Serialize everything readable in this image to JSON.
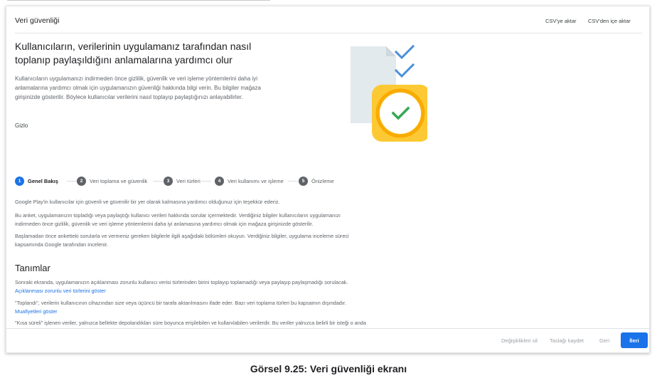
{
  "header": {
    "title": "Veri güvenliği",
    "export_label": "CSV'ye aktar",
    "import_label": "CSV'den içe aktar"
  },
  "hero": {
    "title": "Kullanıcıların, verilerinin uygulamanız tarafından nasıl toplanıp paylaşıldığını anlamalarına yardımcı olur",
    "description": "Kullanıcıların uygulamanızı indirmeden önce gizlilik, güvenlik ve veri işleme yöntemlerini daha iyi anlamalarına yardımcı olmak için uygulamanızın güvenliği hakkında bilgi verin. Bu bilgiler mağaza girişinizde gösterilir. Böylece kullanıcılar verilerini nasıl toplayıp paylaştığınızı anlayabilirler.",
    "link": "Gizlo"
  },
  "illustration": {
    "icon": "checklist-document-with-check-badge-icon",
    "colors": {
      "doc": "#e3eaee",
      "check": "#4a90d9",
      "badge": "#fcc934",
      "badge_inner": "#ffffff",
      "badge_check": "#34a853"
    }
  },
  "steps": [
    {
      "number": "1",
      "label": "Genel Bakış",
      "active": true
    },
    {
      "number": "2",
      "label": "Veri toplama ve güvenlik",
      "active": false
    },
    {
      "number": "3",
      "label": "Veri türleri",
      "active": false
    },
    {
      "number": "4",
      "label": "Veri kullanımı ve işleme",
      "active": false
    },
    {
      "number": "5",
      "label": "Önizleme",
      "active": false
    }
  ],
  "intro": {
    "p1": "Google Play'in kullanıcılar için güvenli ve güvenilir bir yer olarak kalmasına yardımcı olduğunuz için teşekkür ederiz.",
    "p2": "Bu anket, uygulamanızın topladığı veya paylaştığı kullanıcı verileri hakkında sorular içermektedir. Verdiğiniz bilgiler kullanıcıların uygulamanızı indirmeden önce gizlilik, güvenlik ve veri işleme yöntemlerini daha iyi anlamasına yardımcı olmak için mağaza girişinizde gösterilir.",
    "p3": "Başlamadan önce anketteki sorularla ve vermeniz gereken bilgilerle ilgili aşağıdaki bölümleri okuyun. Verdiğiniz bilgiler, uygulama inceleme süreci kapsamında Google tarafından incelenir."
  },
  "definitions": {
    "title": "Tanımlar",
    "d1_text": "Sonraki ekranda, uygulamanızın açıklanması zorunlu kullanıcı verisi türlerinden birini toplayıp toplamadığı veya paylaşıp paylaşmadığı sorulacak.",
    "d1_link": "Açıklanması zorunlu veri türlerini göster",
    "d2_text": "\"Toplandı\", verilerin kullanıcının cihazından size veya üçüncü bir tarafa aktarılmasını ifade eder. Bazı veri toplama türleri bu kapsamın dışındadır.",
    "d2_link": "Muafiyetleri göster",
    "d3_text": "\"Kısa süreli\" işlenen veriler, yalnızca bellekte depolandıkları süre boyunca erişilebilen ve kullanılabilen verilerdir. Bu veriler yalnızca belirli bir isteği o anda yerine getirmek için gereken süre boyunca saklanır. Bu şekilde toplanan verilerin de açıklanması zorunludur ancak bunlar"
  },
  "footer": {
    "discard_label": "Değişiklikleri sil",
    "draft_label": "Taslağı kaydet",
    "back_label": "Geri",
    "next_label": "İleri"
  },
  "caption": "Görsel 9.25: Veri güvenliği ekranı"
}
